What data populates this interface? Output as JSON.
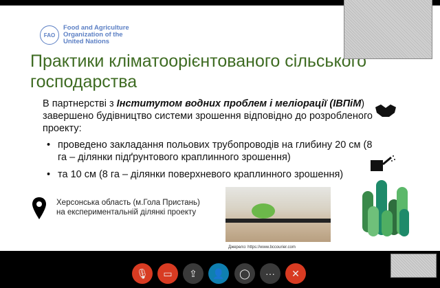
{
  "slide": {
    "logo_text": [
      "Food and Agriculture",
      "Organization of the",
      "United Nations"
    ],
    "logo_emblem": "FAO",
    "title": "Практики кліматоорієнтованого сільського господарства",
    "intro_pre": "В партнерстві з ",
    "intro_bold": "Інститутом водних проблем і меліорації (ІВПіМ",
    "intro_post": ") завершено будівництво системи зрошення відповідно до розробленого проекту:",
    "bullets": [
      "проведено закладання польових трубопроводів на глибину 20 см (8 га – ділянки підґрунтового краплинного зрошення)",
      "та 10 см (8 га – ділянки поверхневого краплинного зрошення)"
    ],
    "location": "Херсонська область (м.Гола Пристань) на експериментальній ділянкі проекту",
    "photo_credit": "Джерело: https://www.bccourier.com"
  },
  "controls": [
    {
      "name": "mute-button",
      "icon": "mic-off-icon",
      "glyph": "🎙",
      "color": "#d83b22"
    },
    {
      "name": "video-button",
      "icon": "camera-off-icon",
      "glyph": "▭",
      "color": "#d83b22"
    },
    {
      "name": "share-button",
      "icon": "share-icon",
      "glyph": "⇪",
      "color": "#3a3a3a"
    },
    {
      "name": "participants-button",
      "icon": "participants-icon",
      "glyph": "👤",
      "color": "#0f7fb0"
    },
    {
      "name": "chat-button",
      "icon": "chat-icon",
      "glyph": "◯",
      "color": "#3a3a3a"
    },
    {
      "name": "more-button",
      "icon": "more-icon",
      "glyph": "···",
      "color": "#3a3a3a"
    },
    {
      "name": "leave-button",
      "icon": "close-icon",
      "glyph": "✕",
      "color": "#d83b22"
    }
  ]
}
